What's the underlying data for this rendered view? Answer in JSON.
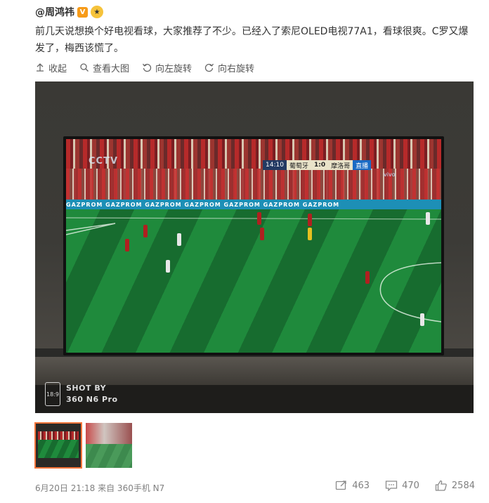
{
  "post": {
    "author": "@周鸿祎",
    "verified_badge": "V",
    "text": "前几天说想换个好电视看球，大家推荐了不少。已经入了索尼OLED电视77A1，看球很爽。C罗又爆发了，梅西该慌了。"
  },
  "actions": {
    "collapse": "收起",
    "view_large": "查看大图",
    "rotate_left": "向左旋转",
    "rotate_right": "向右旋转"
  },
  "photo": {
    "scoreboard": {
      "time": "14:10",
      "home": "葡萄牙",
      "score": "1:0",
      "away": "摩洛哥",
      "live": "直播"
    },
    "broadcaster": "CCTV",
    "sponsor_boards": "GAZPROM   GAZPROM   GAZPROM   GAZPROM   GAZPROM   GAZPROM   GAZPROM",
    "shot_watermark": {
      "ratio": "18:9",
      "line1": "SHOT BY",
      "line2": "360 N6 Pro"
    }
  },
  "footer": {
    "meta": "6月20日 21:18 来自 360手机 N7",
    "reposts": "463",
    "comments": "470",
    "likes": "2584"
  },
  "colors": {
    "text": "#333333",
    "meta": "#808080",
    "selected_thumb": "#f7753a",
    "verified": "#f79b18"
  }
}
